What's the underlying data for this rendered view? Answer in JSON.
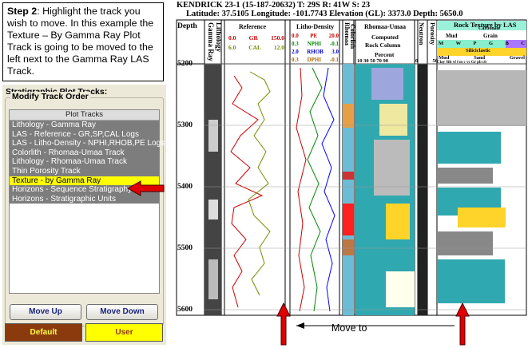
{
  "instructions": {
    "step": "Step 2",
    "text": ": Highlight the track you wish to move. In this example the Texture – By Gamma Ray Plot Track is going to be moved to the left next to the Gamma Ray LAS Track."
  },
  "panel": {
    "title": "Stratigraphic Plot Tracks:",
    "group_label": "Modify Track Order",
    "list_header": "Plot Tracks",
    "items": [
      {
        "label": "Lithology - Gamma Ray"
      },
      {
        "label": "LAS - Reference - GR,SP,CAL Logs"
      },
      {
        "label": "LAS - Litho-Density - NPHI,RHOB,PE Logs"
      },
      {
        "label": "Colorlith - Rhomaa-Umaa Track"
      },
      {
        "label": "Lithology - Rhomaa-Umaa Track"
      },
      {
        "label": "Thin Porosity Track"
      },
      {
        "label": "Texture - by Gamma Ray"
      },
      {
        "label": "Horizons - Sequence Stratigraphy"
      },
      {
        "label": "Horizons - Stratigraphic Units"
      }
    ],
    "selected_index": 6,
    "move_up": "Move Up",
    "move_down": "Move Down",
    "default": "Default",
    "user": "User"
  },
  "plot": {
    "header1": "KENDRICK 23-1 (15-187-20632) T: 29S R: 41W S: 23",
    "header2": "Latitude: 37.5105 Longitude: -101.7743 Elevation (GL): 3373.0 Depth: 5650.0",
    "depth_title": "Depth",
    "depths": [
      "5200",
      "5300",
      "5400",
      "5500",
      "5600"
    ],
    "track_titles": {
      "lith_gr": "Lithology Gamma Ray",
      "reference": "Reference",
      "litho_density": "Litho-Density",
      "colorlith": "Colorlith",
      "rhomaa_umaa": "Rhomaa-Umaa",
      "neutron": "Neutron",
      "porosity": "Porosity",
      "rock_texture": "Rock Texture by LAS",
      "rhomaa": "Rhomaa"
    },
    "reference_scale": {
      "gr": "GR",
      "gr_min": "0.0",
      "gr_max": "150.0",
      "cal": "CAL",
      "cal_min": "6.0",
      "cal_max": "12.0"
    },
    "density_scale": {
      "pe": "PE",
      "pe_min": "0.0",
      "pe_max": "20.0",
      "nphi": "NPHI",
      "nphi_min": "0.3",
      "nphi_max": "-0.1",
      "rhob": "RHOB",
      "rhob_min": "2.0",
      "rhob_max": "3.0",
      "dphi": "DPHI",
      "dphi_min": "0.3",
      "dphi_max": "-0.1"
    },
    "rhomaa_sub": {
      "line1": "Computed",
      "line2": "Rock Column",
      "line3": "Percent",
      "ticks": "10 30 50 70 90"
    },
    "neutron_scale": {
      "min": "0",
      "max": "50"
    },
    "texture_header": {
      "carbonate": "Carbonate",
      "mud": "Mud",
      "grain": "Grain",
      "cols": [
        "M",
        "W",
        "P",
        "G",
        "B",
        "C"
      ],
      "siliciclastic": "Siliciclastic",
      "mud2": "Mud",
      "sand": "Sand",
      "gravel": "Gravel",
      "cols2": "Clay Silt vf f m c vc Gr pb cb"
    },
    "move_to": "Move to"
  }
}
